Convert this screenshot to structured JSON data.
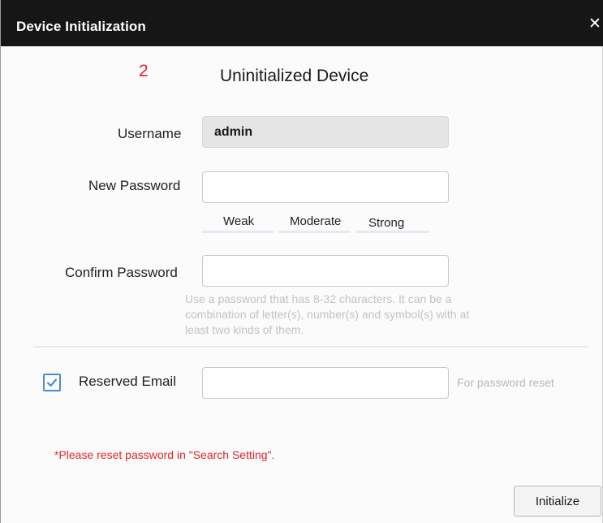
{
  "window": {
    "title": "Device Initialization",
    "close_glyph": "✕"
  },
  "header": {
    "step_number": "2",
    "heading": "Uninitialized Device"
  },
  "form": {
    "username": {
      "label": "Username",
      "value": "admin"
    },
    "new_password": {
      "label": "New Password",
      "value": ""
    },
    "strength": {
      "weak": "Weak",
      "moderate": "Moderate",
      "strong": "Strong"
    },
    "confirm_password": {
      "label": "Confirm Password",
      "value": ""
    },
    "hint": "Use a password that has 8-32 characters. It can be a combination of letter(s), number(s) and symbol(s) with at least two kinds of them.",
    "reserved_email": {
      "label": "Reserved Email",
      "checked": true,
      "value": "",
      "note": "For password reset"
    }
  },
  "warning": "*Please reset password in \"Search Setting\".",
  "buttons": {
    "initialize": "Initialize"
  },
  "colors": {
    "titlebar": "#161616",
    "accent_red": "#e0242c",
    "checkbox_blue": "#4c8ad6"
  },
  "icons": {
    "close": "close-icon",
    "checkbox": "checkmark-icon"
  }
}
